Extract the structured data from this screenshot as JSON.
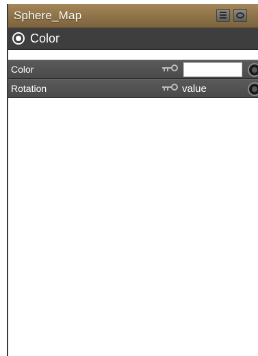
{
  "panel": {
    "title": "Sphere_Map",
    "menu_icon": "list-menu-icon",
    "undock_icon": "eye-icon"
  },
  "section": {
    "title": "Color",
    "icon": "collapse-circle-icon"
  },
  "properties": [
    {
      "label": "Color",
      "value_type": "color-swatch",
      "swatch_color": "#ffffff",
      "key_icon": "keyframe-icon",
      "map_icon": "texture-map-icon"
    },
    {
      "label": "Rotation",
      "value": "value",
      "key_icon": "keyframe-icon",
      "map_icon": "texture-map-icon"
    }
  ],
  "colors": {
    "title_bar": "#8c7247",
    "section_header": "#3e3e3e",
    "row": "#4f4f4f",
    "body": "#ffffff"
  }
}
